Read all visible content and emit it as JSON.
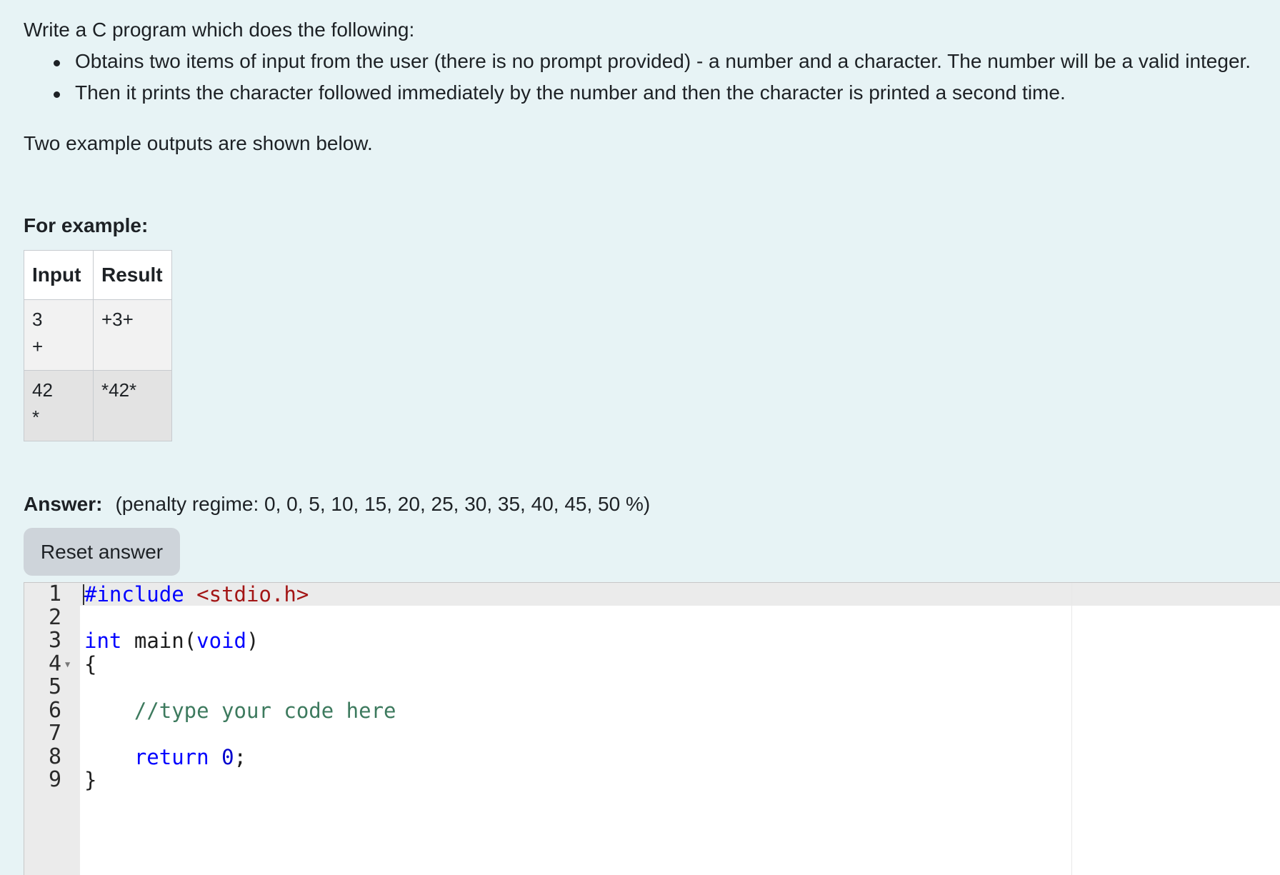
{
  "question": {
    "intro": "Write a C program which does the following:",
    "bullets": [
      "Obtains two items of input from the user (there is no prompt provided) - a number and a character. The number will be a valid integer.",
      "Then it prints the character followed immediately by the number and then the character is printed a second time."
    ],
    "note": "Two example outputs are shown below."
  },
  "examples": {
    "heading": "For example:",
    "headers": [
      "Input",
      "Result"
    ],
    "rows": [
      {
        "input_line1": "3",
        "input_line2": "+",
        "result": "+3+"
      },
      {
        "input_line1": "42",
        "input_line2": "*",
        "result": "*42*"
      }
    ]
  },
  "answer": {
    "label": "Answer:",
    "penalty": "(penalty regime: 0, 0, 5, 10, 15, 20, 25, 30, 35, 40, 45, 50 %)",
    "reset_label": "Reset answer"
  },
  "editor": {
    "line_numbers": [
      "1",
      "2",
      "3",
      "4",
      "5",
      "6",
      "7",
      "8",
      "9"
    ],
    "code": {
      "l1_directive": "#include",
      "l1_header": "<stdio.h>",
      "l3_type": "int",
      "l3_name": "main(",
      "l3_param": "void",
      "l3_close": ")",
      "l4": "{",
      "l6_comment": "//type your code here",
      "l8_keyword": "return",
      "l8_value": "0",
      "l8_end": ";",
      "l9": "}"
    },
    "colors": {
      "keyword": "#0000ff",
      "string": "#a31515",
      "comment": "#3d7a5e",
      "number": "#0000cd"
    }
  }
}
